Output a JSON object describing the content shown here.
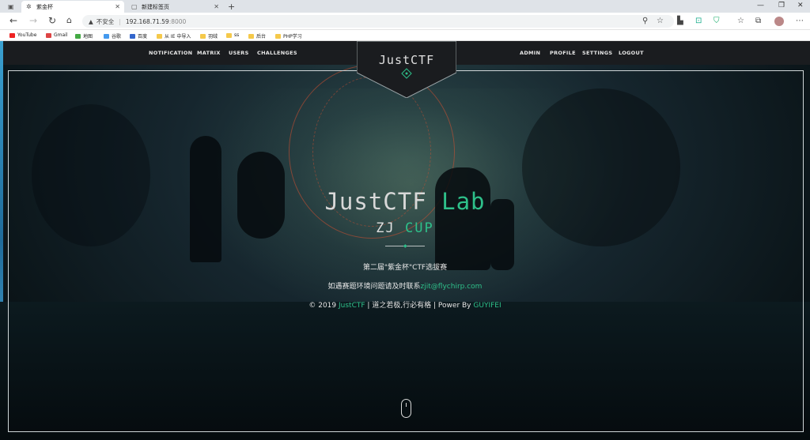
{
  "browser": {
    "tabs": [
      {
        "title": "紫金杯",
        "active": true
      },
      {
        "title": "新建标签页",
        "active": false
      }
    ],
    "address": {
      "insecure_label": "不安全",
      "url_host": "192.168.71.59",
      "url_port": ":8000"
    },
    "bookmarks": [
      "YouTube",
      "Gmail",
      "地图",
      "谷歌",
      "百度",
      "从 IE 中导入",
      "羽绒",
      "ss",
      "后台",
      "PHP学习"
    ]
  },
  "site": {
    "nav_left": [
      "NOTIFICATION",
      "MATRIX",
      "USERS",
      "CHALLENGES"
    ],
    "nav_right": [
      "ADMIN",
      "PROFILE",
      "SETTINGS",
      "LOGOUT"
    ],
    "logo": "JustCTF",
    "title_main": "JustCTF",
    "title_accent": "Lab",
    "subtitle_main": "ZJ",
    "subtitle_accent": "CUP",
    "event_line": "第二届\"紫金杯\"CTF选拔赛",
    "contact_prefix": "如遇赛题环境问题请及时联系",
    "contact_email": "zjit@flychirp.com",
    "footer_copy": "© 2019",
    "footer_brand": "JustCTF",
    "footer_middle": "| 道之若极,行必有格 | Power By",
    "footer_author": "GUYIFEI"
  },
  "colors": {
    "accent": "#2ec08a",
    "nav_bg": "#1a1c1f",
    "text": "#e6e6e6"
  }
}
